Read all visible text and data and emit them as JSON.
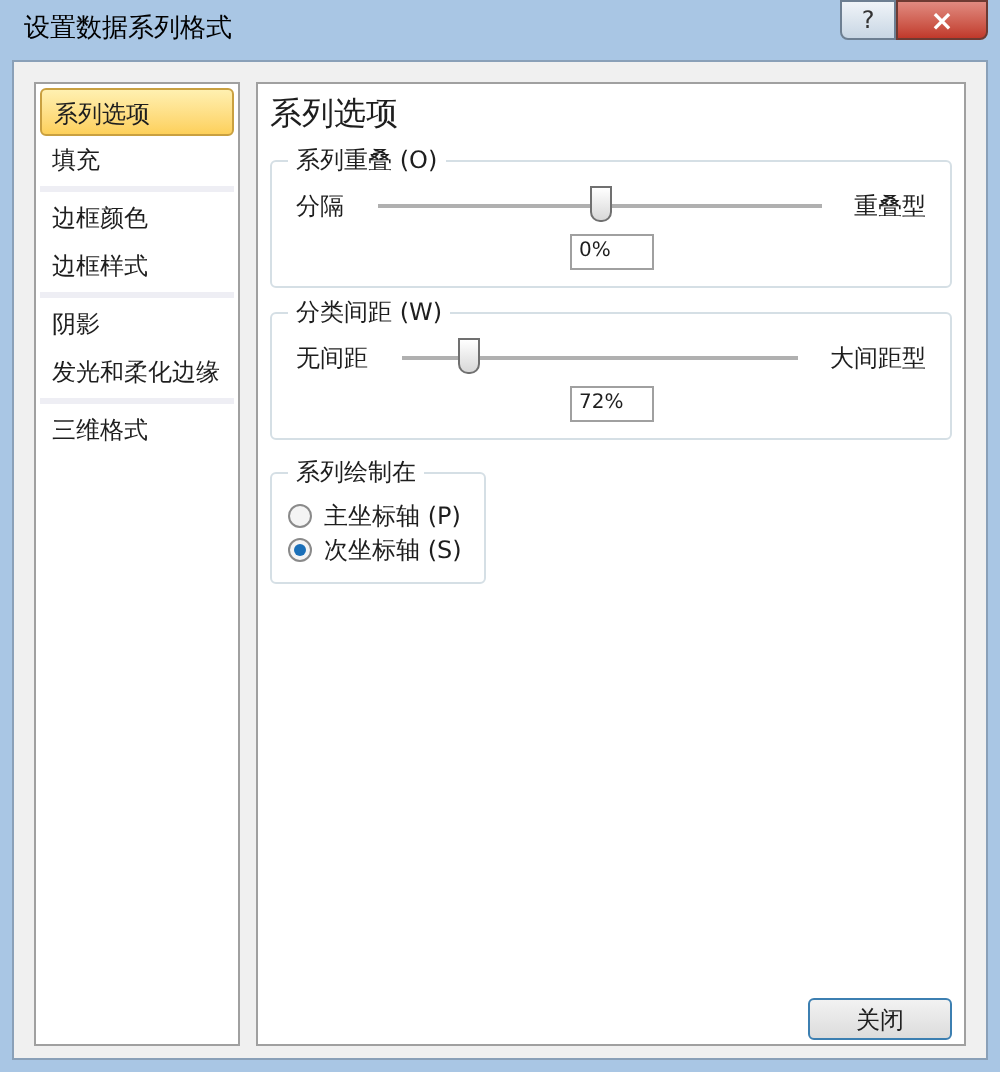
{
  "window": {
    "title": "设置数据系列格式",
    "buttons": [
      "?",
      "×"
    ]
  },
  "sidebar": {
    "items": [
      {
        "label": "系列选项",
        "selected": true,
        "divider_after": false
      },
      {
        "label": "填充",
        "selected": false,
        "divider_after": true
      },
      {
        "label": "边框颜色",
        "selected": false,
        "divider_after": false
      },
      {
        "label": "边框样式",
        "selected": false,
        "divider_after": true
      },
      {
        "label": "阴影",
        "selected": false,
        "divider_after": false
      },
      {
        "label": "发光和柔化边缘",
        "selected": false,
        "divider_after": true
      },
      {
        "label": "三维格式",
        "selected": false,
        "divider_after": false
      }
    ]
  },
  "panel": {
    "title": "系列选项",
    "sliders": [
      {
        "group": "系列重叠 (O)",
        "min_label": "分隔",
        "max_label": "重叠型",
        "level": 0.5,
        "value": "0%"
      },
      {
        "group": "分类间距 (W)",
        "min_label": "无间距",
        "max_label": "大间距型",
        "level": 0.17,
        "value": "72%"
      }
    ],
    "plot_on": {
      "group": "系列绘制在",
      "options": [
        {
          "label": "主坐标轴 (P)",
          "selected": false
        },
        {
          "label": "次坐标轴 (S)",
          "selected": true
        }
      ]
    }
  },
  "footer": {
    "close_button": "关闭"
  }
}
